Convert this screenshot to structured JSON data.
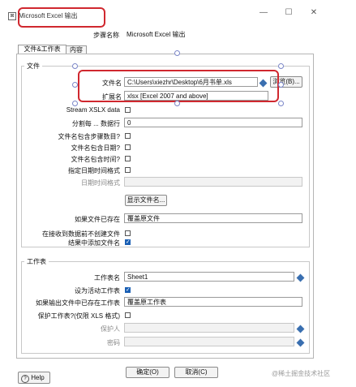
{
  "window": {
    "title": "Microsoft Excel 输出",
    "minimize": "—",
    "maximize": "☐",
    "close": "✕"
  },
  "step": {
    "label": "步骤名称",
    "value": "Microsoft Excel 输出"
  },
  "tabs": [
    {
      "label": "文件&工作表"
    },
    {
      "label": "内容"
    }
  ],
  "file_section": {
    "title": "文件",
    "filename_label": "文件名",
    "filename_value": "C:\\Users\\xiezhr\\Desktop\\6月书单.xls",
    "browse_label": "浏览(B)...",
    "extension_label": "扩展名",
    "extension_value": "xlsx [Excel 2007 and above]",
    "stream_label": "Stream XSLX data",
    "split_label": "分割每 ... 数据行",
    "split_value": "0",
    "include_stepnr_label": "文件名包含步骤数目?",
    "include_date_label": "文件名包含日期?",
    "include_time_label": "文件名包含时间?",
    "specify_format_label": "指定日期时间格式",
    "date_format_label": "日期时间格式",
    "show_files_label": "显示文件名...",
    "if_file_exists_label": "如果文件已存在",
    "if_file_exists_value": "覆盖原文件",
    "no_create_label": "在接收到数据前不创建文件",
    "add_to_result_label": "结果中添加文件名"
  },
  "sheet_section": {
    "title": "工作表",
    "sheet_name_label": "工作表名",
    "sheet_name_value": "Sheet1",
    "active_sheet_label": "设为活动工作表",
    "if_sheet_exists_label": "如果输出文件中已存在工作表",
    "if_sheet_exists_value": "覆盖原工作表",
    "protect_label": "保护工作表?(仅限 XLS 格式)",
    "protected_by_label": "保护人",
    "password_label": "密码"
  },
  "buttons": {
    "ok": "确定(O)",
    "cancel": "取消(C)",
    "help": "Help"
  },
  "watermark": "@稀土掘金技术社区",
  "colors": {
    "annotation_red": "#d0282f",
    "checkbox_blue": "#1a5fb4",
    "handle_blue": "#7a86c8"
  }
}
